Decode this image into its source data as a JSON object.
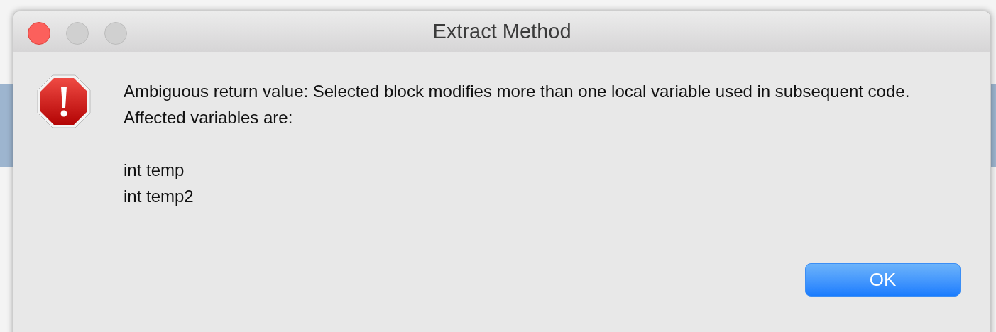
{
  "window": {
    "title": "Extract Method"
  },
  "message": "Ambiguous return value: Selected block modifies more than one local variable used in subsequent code. Affected variables are:",
  "variables": [
    "int temp",
    "int temp2"
  ],
  "buttons": [
    {
      "label": "OK",
      "default": true
    }
  ]
}
